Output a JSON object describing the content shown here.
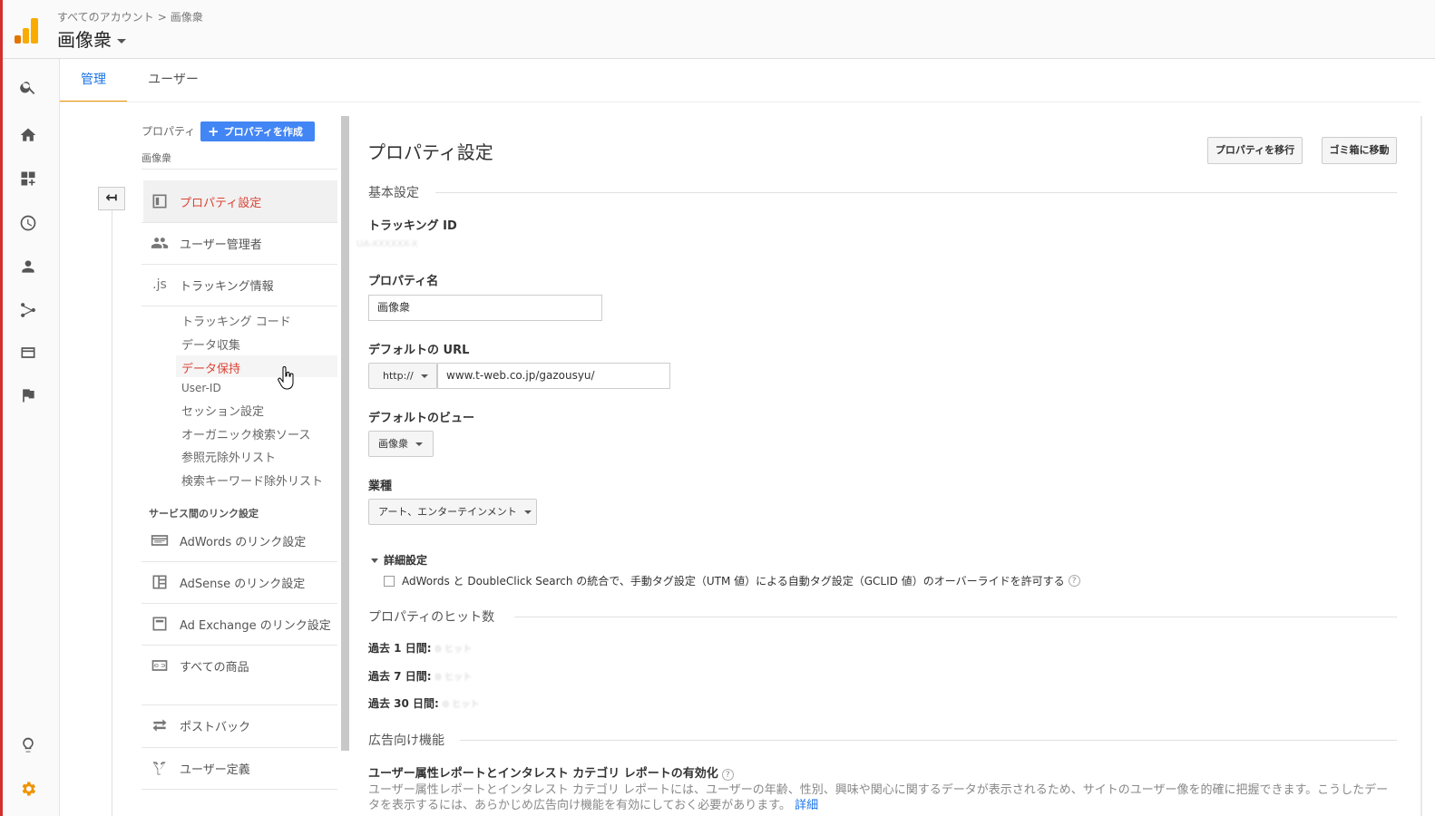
{
  "header": {
    "breadcrumb": [
      "すべてのアカウント",
      "画像衆"
    ],
    "breadcrumb_sep": ">",
    "title": "画像衆"
  },
  "colors": {
    "accent": "#1a73e8",
    "active_red": "#db4437",
    "tab_underline": "#f09300",
    "create_btn": "#4285f4"
  },
  "rail_icons": [
    "search-icon",
    "home-icon",
    "dashboard-add-icon",
    "clock-icon",
    "person-icon",
    "flow-icon",
    "display-icon",
    "flag-icon",
    "lightbulb-icon",
    "gear-icon"
  ],
  "tabs": [
    {
      "label": "管理",
      "active": true
    },
    {
      "label": "ユーザー",
      "active": false
    }
  ],
  "back_button": "↤",
  "nav": {
    "header": "プロパティ",
    "create_button": "プロパティを作成",
    "create_plus": "+",
    "sub_header": "画像衆",
    "items": [
      {
        "label": "プロパティ設定",
        "icon": "property-icon",
        "active": true
      },
      {
        "label": "ユーザー管理者",
        "icon": "users-icon",
        "active": false
      },
      {
        "label": "トラッキング情報",
        "icon": "js-icon",
        "icon_text": ".js",
        "active": false
      }
    ],
    "sub_links": [
      "トラッキング コード",
      "データ収集",
      "データ保持",
      "User-ID",
      "セッション設定",
      "オーガニック検索ソース",
      "参照元除外リスト",
      "検索キーワード除外リスト"
    ],
    "sub_active_index": 2,
    "link_section": "サービス間のリンク設定",
    "link_items": [
      {
        "label": "AdWords のリンク設定",
        "icon": "adwords-icon"
      },
      {
        "label": "AdSense のリンク設定",
        "icon": "adsense-icon"
      },
      {
        "label": "Ad Exchange のリンク設定",
        "icon": "adexchange-icon"
      },
      {
        "label": "すべての商品",
        "icon": "link-icon"
      },
      {
        "label": "ポストバック",
        "icon": "postback-icon"
      },
      {
        "label": "ユーザー定義",
        "icon": "fork-icon"
      }
    ]
  },
  "main": {
    "title": "プロパティ設定",
    "move_button": "プロパティを移行",
    "trash_button": "ゴミ箱に移動",
    "basic_section": "基本設定",
    "tracking_id_label": "トラッキング ID",
    "tracking_id_value": "UA-XXXXXX-X",
    "property_name_label": "プロパティ名",
    "property_name_value": "画像衆",
    "default_url_label": "デフォルトの URL",
    "protocol": "http://",
    "url_value": "www.t-web.co.jp/gazousyu/",
    "default_view_label": "デフォルトのビュー",
    "default_view_value": "画像衆",
    "industry_label": "業種",
    "industry_value": "アート、エンターテインメント",
    "advanced_label": "詳細設定",
    "override_text": "AdWords と DoubleClick Search の統合で、手動タグ設定（UTM 値）による自動タグ設定（GCLID 値）のオーバーライドを許可する",
    "help_glyph": "?",
    "hits_section": "プロパティのヒット数",
    "hits": [
      {
        "label": "過去 1 日間:",
        "value": "0 ヒット"
      },
      {
        "label": "過去 7 日間:",
        "value": "0 ヒット"
      },
      {
        "label": "過去 30 日間:",
        "value": "0 ヒット"
      }
    ],
    "ads_section": "広告向け機能",
    "demographics_label": "ユーザー属性レポートとインタレスト カテゴリ レポートの有効化",
    "demographics_desc": "ユーザー属性レポートとインタレスト カテゴリ レポートには、ユーザーの年齢、性別、興味や関心に関するデータが表示されるため、サイトのユーザー像を的確に把握できます。こうしたデータを表示するには、あらかじめ広告向け機能を有効にしておく必要があります。",
    "details_link": "詳細"
  }
}
